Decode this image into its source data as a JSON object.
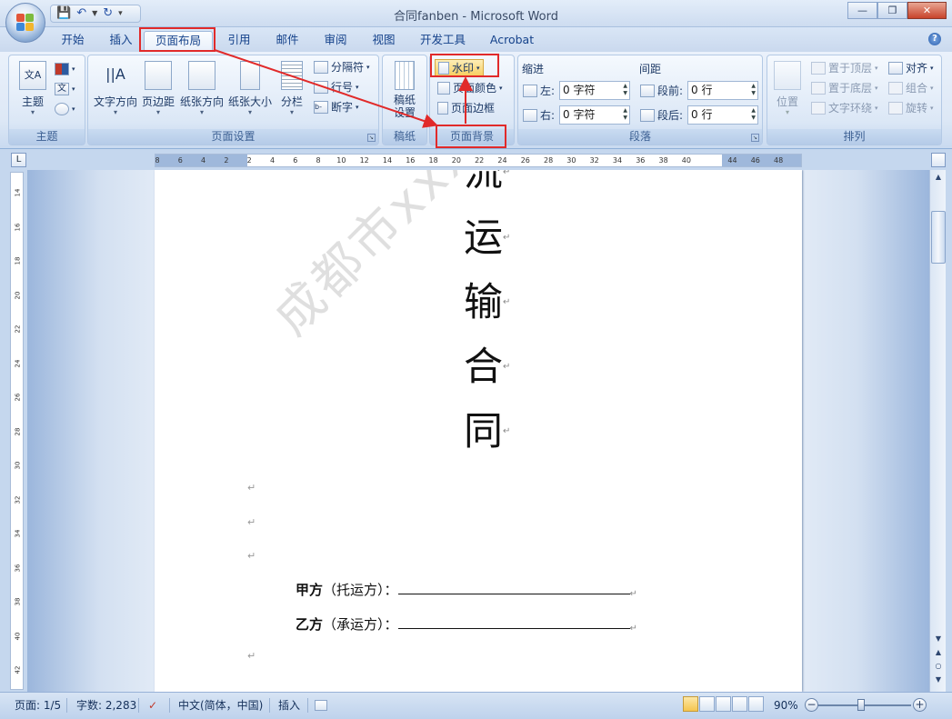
{
  "window": {
    "title": "合同fanben - Microsoft Word",
    "quick_access": [
      "save-icon",
      "undo-icon",
      "redo-icon",
      "customize-icon"
    ]
  },
  "tabs": [
    {
      "label": "开始"
    },
    {
      "label": "插入"
    },
    {
      "label": "页面布局",
      "active": true
    },
    {
      "label": "引用"
    },
    {
      "label": "邮件"
    },
    {
      "label": "审阅"
    },
    {
      "label": "视图"
    },
    {
      "label": "开发工具"
    },
    {
      "label": "Acrobat"
    }
  ],
  "ribbon": {
    "theme": {
      "label": "主题",
      "themes": "主题",
      "group": "主题"
    },
    "page_setup": {
      "text_direction": "文字方向",
      "margins": "页边距",
      "orientation": "纸张方向",
      "size": "纸张大小",
      "columns": "分栏",
      "breaks": "分隔符",
      "line_numbers": "行号",
      "hyphenation": "断字",
      "group": "页面设置"
    },
    "draft": {
      "label1": "稿纸",
      "label2": "设置",
      "group": "稿纸"
    },
    "page_background": {
      "watermark": "水印",
      "page_color": "页面颜色",
      "page_border": "页面边框",
      "group": "页面背景"
    },
    "paragraph": {
      "indent_title": "缩进",
      "spacing_title": "间距",
      "left_label": "左:",
      "left_value": "0 字符",
      "right_label": "右:",
      "right_value": "0 字符",
      "before_label": "段前:",
      "before_value": "0 行",
      "after_label": "段后:",
      "after_value": "0 行",
      "group": "段落"
    },
    "arrange": {
      "position": "位置",
      "bring_front": "置于顶层",
      "send_back": "置于底层",
      "text_wrap": "文字环绕",
      "align": "对齐",
      "group_btn": "组合",
      "rotate": "旋转",
      "group": "排列"
    }
  },
  "ruler": {
    "ticks": [
      "8",
      "6",
      "4",
      "2",
      "2",
      "4",
      "6",
      "8",
      "10",
      "12",
      "14",
      "16",
      "18",
      "20",
      "22",
      "24",
      "26",
      "28",
      "30",
      "32",
      "34",
      "36",
      "38",
      "40",
      "44",
      "46",
      "48"
    ],
    "vticks": [
      "14",
      "16",
      "18",
      "20",
      "22",
      "24",
      "26",
      "28",
      "30",
      "32",
      "34",
      "36",
      "38",
      "40",
      "42"
    ]
  },
  "document": {
    "title_chars": [
      "流",
      "运",
      "输",
      "合",
      "同"
    ],
    "party_a_bold": "甲方",
    "party_a_rest": "（托运方）：",
    "party_b_bold": "乙方",
    "party_b_rest": "（承运方）：",
    "watermark": "成都市xxxx有限责任公司"
  },
  "status": {
    "page": "页面: 1/5",
    "words": "字数: 2,283",
    "language": "中文(简体，中国)",
    "mode": "插入",
    "zoom": "90%"
  },
  "annotation_color": "#e12a2a"
}
